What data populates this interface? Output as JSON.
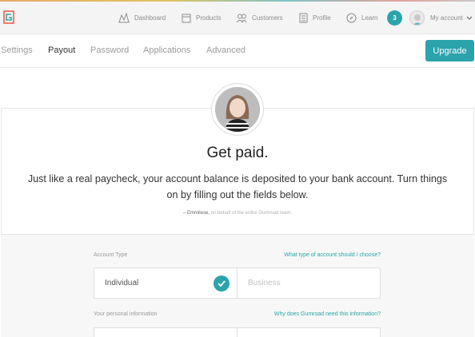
{
  "nav": {
    "items": [
      {
        "label": "Dashboard",
        "icon": "dashboard-icon"
      },
      {
        "label": "Products",
        "icon": "products-icon"
      },
      {
        "label": "Customers",
        "icon": "customers-icon"
      },
      {
        "label": "Profile",
        "icon": "profile-icon"
      },
      {
        "label": "Learn",
        "icon": "compass-icon"
      }
    ],
    "notification_count": "3",
    "account_label": "My account"
  },
  "tabs": {
    "items": [
      "Settings",
      "Payout",
      "Password",
      "Applications",
      "Advanced"
    ],
    "active": "Payout",
    "upgrade_label": "Upgrade"
  },
  "hero": {
    "heading": "Get paid.",
    "lede": "Just like a real paycheck, your account balance is deposited to your bank account. Turn things on by filling out the fields below.",
    "signature_name": "– Emmilese,",
    "signature_rest": "on behalf of the entire Gumroad team."
  },
  "form": {
    "account_type_label": "Account Type",
    "account_type_help": "What type of account should I choose?",
    "options": [
      "Individual",
      "Business"
    ],
    "selected": "Individual",
    "personal_info_label": "Your personal information",
    "personal_info_help": "Why does Gumroad need this information?"
  },
  "colors": {
    "accent": "#2ba3ab",
    "nav_bg": "#f4f4f4"
  }
}
